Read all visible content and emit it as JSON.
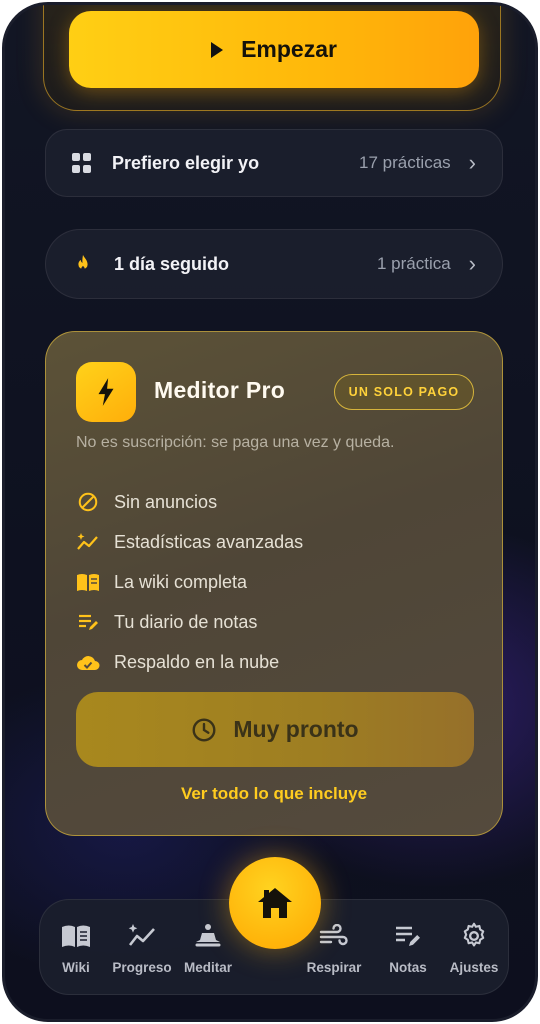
{
  "start": {
    "label": "Empezar"
  },
  "choose": {
    "title": "Prefiero elegir yo",
    "meta": "17 prácticas"
  },
  "streak": {
    "title": "1 día seguido",
    "meta": "1 práctica"
  },
  "pro": {
    "title": "Meditor Pro",
    "badge": "UN SOLO PAGO",
    "description": "No es suscripción: se paga una vez y queda.",
    "features": [
      {
        "icon": "no-ads-icon",
        "text": "Sin anuncios"
      },
      {
        "icon": "stats-sparkle-icon",
        "text": "Estadísticas avanzadas"
      },
      {
        "icon": "book-icon",
        "text": "La wiki completa"
      },
      {
        "icon": "notes-edit-icon",
        "text": "Tu diario de notas"
      },
      {
        "icon": "cloud-check-icon",
        "text": "Respaldo en la nube"
      }
    ],
    "soon_label": "Muy pronto",
    "see_all": "Ver todo lo que incluye"
  },
  "nav": {
    "items": [
      {
        "icon": "book-icon",
        "label": "Wiki"
      },
      {
        "icon": "progress-chart-icon",
        "label": "Progreso"
      },
      {
        "icon": "meditate-icon",
        "label": "Meditar"
      },
      {
        "icon": "wind-icon",
        "label": "Respirar"
      },
      {
        "icon": "notes-icon",
        "label": "Notas"
      },
      {
        "icon": "gear-icon",
        "label": "Ajustes"
      }
    ],
    "home_icon": "home-icon"
  },
  "colors": {
    "accent": "#ffbe12",
    "background": "#10131f",
    "pro_card": "#534a38"
  }
}
